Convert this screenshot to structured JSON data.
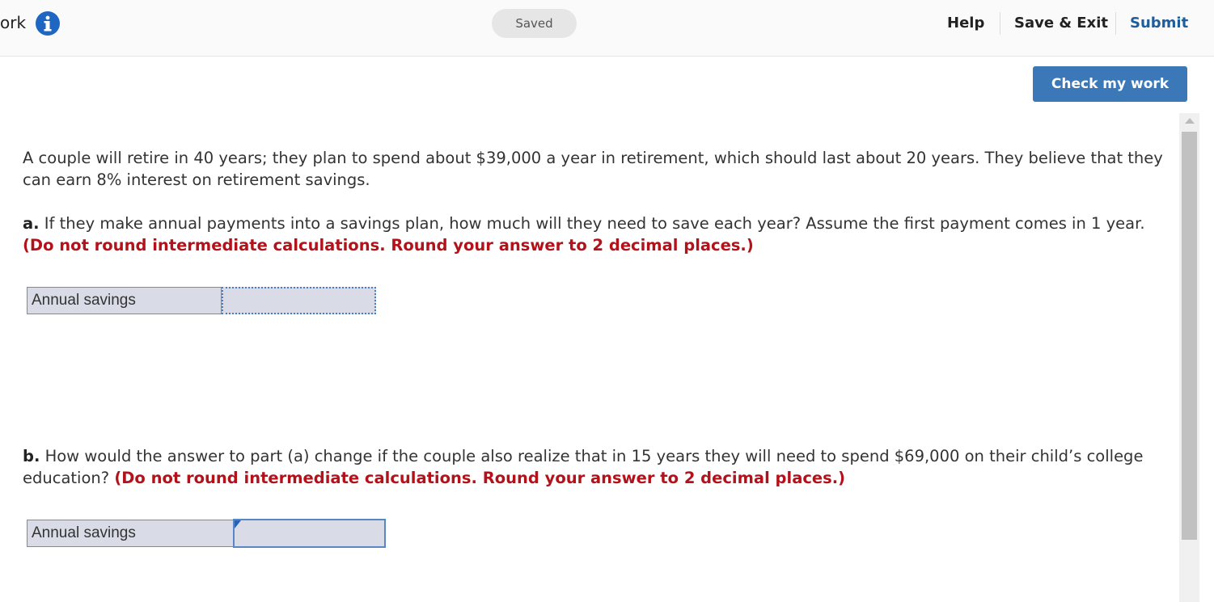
{
  "header": {
    "title_partial": "ork",
    "saved_label": "Saved",
    "help_label": "Help",
    "save_exit_label": "Save & Exit",
    "submit_label": "Submit"
  },
  "check_button_label": "Check my work",
  "question": {
    "intro": "A couple will retire in 40 years; they plan to spend about $39,000 a year in retirement, which should last about 20 years. They believe that they can earn 8% interest on retirement savings.",
    "part_a": {
      "label": "a.",
      "text": "If they make annual payments into a savings plan, how much will they need to save each year? Assume the first payment comes in 1 year.",
      "instruction": "(Do not round intermediate calculations. Round your answer to 2 decimal places.)",
      "field_label": "Annual savings",
      "value": ""
    },
    "part_b": {
      "label": "b.",
      "text": "How would the answer to part (a) change if the couple also realize that in 15 years they will need to spend $69,000 on their child’s college education?",
      "instruction": "(Do not round intermediate calculations. Round your answer to 2 decimal places.)",
      "field_label": "Annual savings",
      "value": ""
    }
  },
  "colors": {
    "accent": "#3a78b8",
    "submit": "#1f5d9b",
    "instruction_red": "#b3121a",
    "field_bg": "#d9dce6"
  }
}
